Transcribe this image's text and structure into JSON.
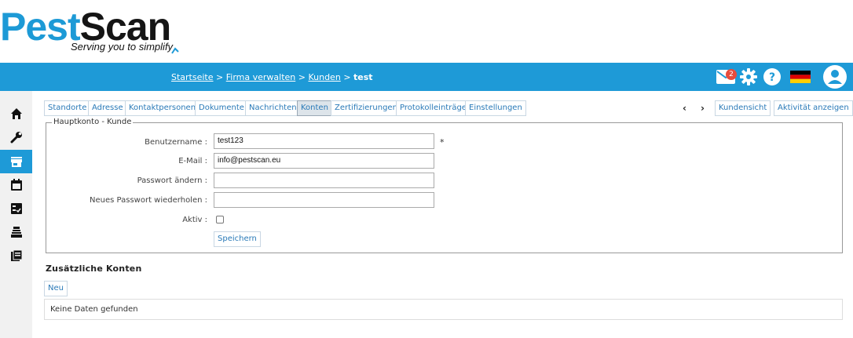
{
  "logo": {
    "part1": "Pest",
    "part2": "Scan",
    "tagline": "Serving you to simplify"
  },
  "breadcrumb": {
    "items": [
      "Startseite",
      "Firma verwalten",
      "Kunden"
    ],
    "separator": ">",
    "current": "test"
  },
  "topbar": {
    "mail_badge": "2",
    "icons": [
      "mail-icon",
      "gear-icon",
      "help-icon",
      "german-flag-icon",
      "user-avatar-icon"
    ],
    "bg_color": "#1e9ad7"
  },
  "leftnav": {
    "icons": [
      "home-icon",
      "wrench-icon",
      "store-icon",
      "calendar-icon",
      "checklist-icon",
      "trap-icon",
      "book-icon"
    ],
    "active_index": 2
  },
  "tabs": {
    "items": [
      "Standorte",
      "Adresse",
      "Kontaktpersonen",
      "Dokumente",
      "Nachrichten",
      "Konten",
      "Zertifizierungen",
      "Protokolleinträge",
      "Einstellungen"
    ],
    "active": "Konten",
    "prev": "‹",
    "next": "›",
    "kundensicht": "Kundensicht",
    "aktivitaet": "Aktivität anzeigen"
  },
  "form": {
    "legend": "Hauptkonto - Kunde",
    "username_label": "Benutzername :",
    "username_value": "test123",
    "required_marker": "*",
    "email_label": "E-Mail :",
    "email_value": "info@pestscan.eu",
    "password_label": "Passwort ändern :",
    "password_repeat_label": "Neues Passwort wiederholen :",
    "active_label": "Aktiv :",
    "active_checked": false,
    "save_label": "Speichern"
  },
  "additional": {
    "heading": "Zusätzliche Konten",
    "new_label": "Neu",
    "empty_text": "Keine Daten gefunden"
  }
}
